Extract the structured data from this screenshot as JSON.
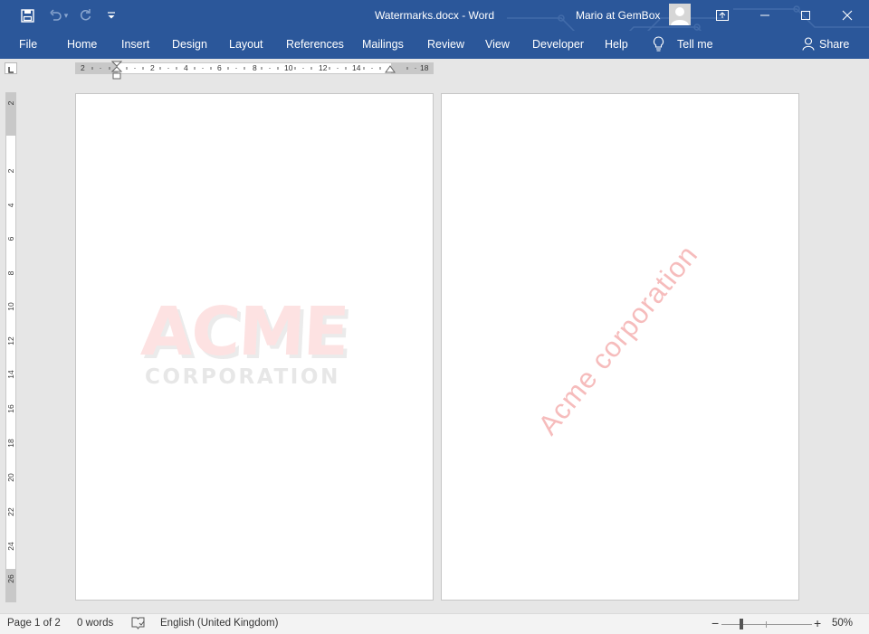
{
  "window": {
    "doc_title": "Watermarks.docx  -  Word",
    "user_name": "Mario at GemBox"
  },
  "ribbon": {
    "tabs": [
      "File",
      "Home",
      "Insert",
      "Design",
      "Layout",
      "References",
      "Mailings",
      "Review",
      "View",
      "Developer",
      "Help"
    ],
    "tell_me": "Tell me",
    "share": "Share"
  },
  "ruler": {
    "h_labels": [
      "2",
      "2",
      "4",
      "6",
      "8",
      "10",
      "12",
      "14",
      "18"
    ],
    "v_labels": [
      "2",
      "2",
      "4",
      "6",
      "8",
      "10",
      "12",
      "14",
      "16",
      "18",
      "20",
      "22",
      "24",
      "26"
    ]
  },
  "pages": {
    "page1_watermark_title": "ACME",
    "page1_watermark_sub": "CORPORATION",
    "page2_watermark": "Acme corporation"
  },
  "status": {
    "page": "Page 1 of 2",
    "words": "0 words",
    "language": "English (United Kingdom)",
    "zoom_minus": "−",
    "zoom_plus": "+",
    "zoom": "50%",
    "zoom_level": 0.22
  },
  "colors": {
    "ribbon": "#2b579a",
    "watermark_red": "#f6bcbc"
  },
  "icons": [
    "save-icon",
    "undo-icon",
    "redo-icon",
    "customize-qat-icon",
    "ribbon-display-icon",
    "minimize-icon",
    "maximize-icon",
    "close-icon",
    "lightbulb-icon",
    "share-person-icon",
    "proofing-icon"
  ]
}
